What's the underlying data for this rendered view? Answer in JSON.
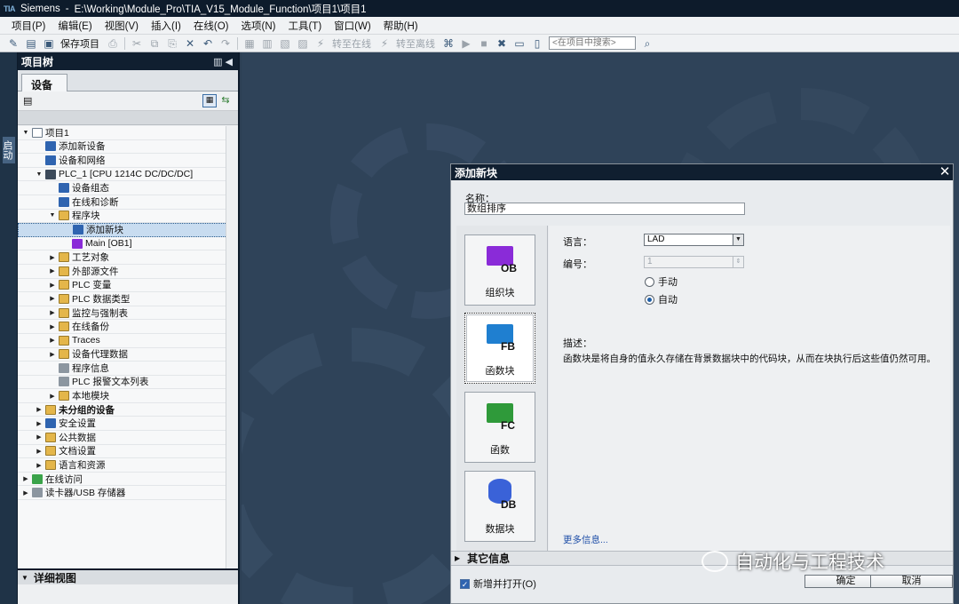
{
  "window": {
    "app_name": "Siemens",
    "path": "E:\\Working\\Module_Pro\\TIA_V15_Module_Function\\项目1\\项目1"
  },
  "menu": [
    "项目(P)",
    "编辑(E)",
    "视图(V)",
    "插入(I)",
    "在线(O)",
    "选项(N)",
    "工具(T)",
    "窗口(W)",
    "帮助(H)"
  ],
  "toolbar": {
    "save_project": "保存项目",
    "go_online": "转至在线",
    "go_offline": "转至离线",
    "search_placeholder": "<在项目中搜索>"
  },
  "sidebar": {
    "vertical_tab": "启动"
  },
  "project_tree": {
    "title": "项目树",
    "devices_tab": "设备",
    "items": [
      {
        "label": "项目1",
        "level": 0,
        "arrow": "down",
        "icon": "doc",
        "bold": false
      },
      {
        "label": "添加新设备",
        "level": 1,
        "arrow": "",
        "icon": "blue",
        "bold": false
      },
      {
        "label": "设备和网络",
        "level": 1,
        "arrow": "",
        "icon": "blue",
        "bold": false
      },
      {
        "label": "PLC_1 [CPU 1214C DC/DC/DC]",
        "level": 1,
        "arrow": "down",
        "icon": "cpu",
        "bold": false
      },
      {
        "label": "设备组态",
        "level": 2,
        "arrow": "",
        "icon": "blue",
        "bold": false
      },
      {
        "label": "在线和诊断",
        "level": 2,
        "arrow": "",
        "icon": "blue",
        "bold": false
      },
      {
        "label": "程序块",
        "level": 2,
        "arrow": "down",
        "icon": "folder",
        "bold": false
      },
      {
        "label": "添加新块",
        "level": 3,
        "arrow": "",
        "icon": "blue",
        "bold": false,
        "selected": true
      },
      {
        "label": "Main [OB1]",
        "level": 3,
        "arrow": "",
        "icon": "purple",
        "bold": false
      },
      {
        "label": "工艺对象",
        "level": 2,
        "arrow": "right",
        "icon": "folder",
        "bold": false
      },
      {
        "label": "外部源文件",
        "level": 2,
        "arrow": "right",
        "icon": "folder",
        "bold": false
      },
      {
        "label": "PLC 变量",
        "level": 2,
        "arrow": "right",
        "icon": "folder",
        "bold": false
      },
      {
        "label": "PLC 数据类型",
        "level": 2,
        "arrow": "right",
        "icon": "folder",
        "bold": false
      },
      {
        "label": "监控与强制表",
        "level": 2,
        "arrow": "right",
        "icon": "folder",
        "bold": false
      },
      {
        "label": "在线备份",
        "level": 2,
        "arrow": "right",
        "icon": "folder",
        "bold": false
      },
      {
        "label": "Traces",
        "level": 2,
        "arrow": "right",
        "icon": "folder",
        "bold": false
      },
      {
        "label": "设备代理数据",
        "level": 2,
        "arrow": "right",
        "icon": "folder",
        "bold": false
      },
      {
        "label": "程序信息",
        "level": 2,
        "arrow": "",
        "icon": "gray",
        "bold": false
      },
      {
        "label": "PLC 报警文本列表",
        "level": 2,
        "arrow": "",
        "icon": "gray",
        "bold": false
      },
      {
        "label": "本地模块",
        "level": 2,
        "arrow": "right",
        "icon": "folder",
        "bold": false
      },
      {
        "label": "未分组的设备",
        "level": 1,
        "arrow": "right",
        "icon": "folder",
        "bold": true
      },
      {
        "label": "安全设置",
        "level": 1,
        "arrow": "right",
        "icon": "blue",
        "bold": false
      },
      {
        "label": "公共数据",
        "level": 1,
        "arrow": "right",
        "icon": "folder",
        "bold": false
      },
      {
        "label": "文档设置",
        "level": 1,
        "arrow": "right",
        "icon": "folder",
        "bold": false
      },
      {
        "label": "语言和资源",
        "level": 1,
        "arrow": "right",
        "icon": "folder",
        "bold": false
      },
      {
        "label": "在线访问",
        "level": 0,
        "arrow": "right",
        "icon": "green",
        "bold": false
      },
      {
        "label": "读卡器/USB 存储器",
        "level": 0,
        "arrow": "right",
        "icon": "gray",
        "bold": false
      }
    ],
    "detail_view": "详细视图"
  },
  "dialog": {
    "title": "添加新块",
    "name_label": "名称：",
    "name_value": "数组排序",
    "blocks": [
      {
        "code": "OB",
        "label": "组织块",
        "color": "#8a2bd8",
        "selected": false
      },
      {
        "code": "FB",
        "label": "函数块",
        "color": "#1f7fd0",
        "selected": true
      },
      {
        "code": "FC",
        "label": "函数",
        "color": "#2f9a3a",
        "selected": false
      },
      {
        "code": "DB",
        "label": "数据块",
        "color": "#3a62d8",
        "selected": false
      }
    ],
    "language_label": "语言：",
    "language_value": "LAD",
    "number_label": "编号：",
    "number_value": "1",
    "manual_label": "手动",
    "auto_label": "自动",
    "number_mode": "auto",
    "description_label": "描述：",
    "description_text": "函数块是将自身的值永久存储在背景数据块中的代码块，从而在块执行后这些值仍然可用。",
    "more_info": "更多信息...",
    "other_info": "其它信息",
    "open_new_label": "新增并打开(O)",
    "open_new_checked": true,
    "ok_label": "确定",
    "cancel_label": "取消"
  },
  "watermark": "自动化与工程技术"
}
